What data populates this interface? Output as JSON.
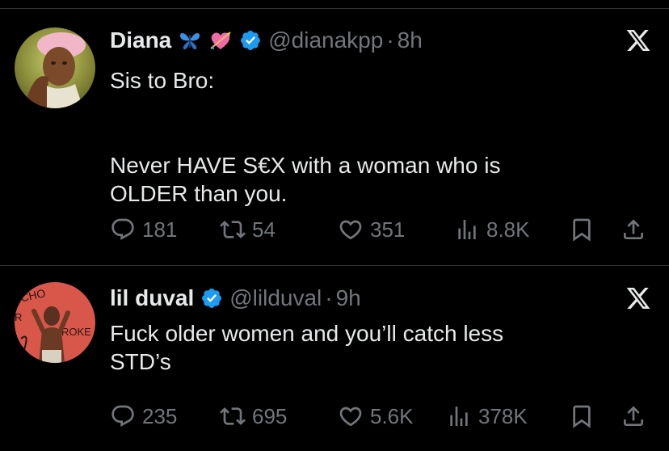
{
  "colors": {
    "background": "#000000",
    "text": "#e7e9ea",
    "secondary_text": "#71767b",
    "divider": "#2f3336",
    "verified_blue": "#1d9bf0"
  },
  "tweets": [
    {
      "display_name": "Diana",
      "emojis": [
        "blue-butterfly-emoji",
        "heart-with-arrow-emoji"
      ],
      "verified": true,
      "handle": "@dianakpp",
      "separator": "·",
      "time": "8h",
      "text_lines": [
        "Sis to Bro:",
        "",
        "Never HAVE S€X with a woman who is",
        "OLDER than you."
      ],
      "replies": "181",
      "reposts": "54",
      "likes": "351",
      "views": "8.8K",
      "icons": {
        "reply": "reply-icon",
        "repost": "repost-icon",
        "like": "heart-icon",
        "views": "views-chart-icon",
        "bookmark": "bookmark-icon",
        "share": "share-icon",
        "platform": "x-logo-icon"
      }
    },
    {
      "display_name": "lil duval",
      "emojis": [],
      "verified": true,
      "handle": "@lilduval",
      "separator": "·",
      "time": "9h",
      "text_lines": [
        "Fuck older women and you’ll catch less",
        "STD’s"
      ],
      "replies": "235",
      "reposts": "695",
      "likes": "5.6K",
      "views": "378K",
      "icons": {
        "reply": "reply-icon",
        "repost": "repost-icon",
        "like": "heart-icon",
        "views": "views-chart-icon",
        "bookmark": "bookmark-icon",
        "share": "share-icon",
        "platform": "x-logo-icon"
      }
    }
  ]
}
